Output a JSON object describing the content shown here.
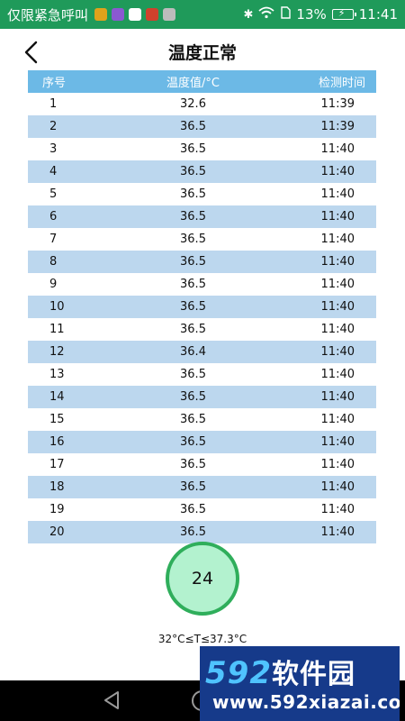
{
  "status_bar": {
    "carrier": "仅限紧急呼叫",
    "battery_percent": "13%",
    "time": "11:41",
    "notification_colors": [
      "#e0a21b",
      "#8a59d1",
      "#ffffff",
      "#d0412c",
      "#bcbcbc"
    ]
  },
  "header": {
    "title": "温度正常"
  },
  "table": {
    "columns": [
      "序号",
      "温度值/°C",
      "检测时间"
    ],
    "rows": [
      [
        "1",
        "32.6",
        "11:39"
      ],
      [
        "2",
        "36.5",
        "11:39"
      ],
      [
        "3",
        "36.5",
        "11:40"
      ],
      [
        "4",
        "36.5",
        "11:40"
      ],
      [
        "5",
        "36.5",
        "11:40"
      ],
      [
        "6",
        "36.5",
        "11:40"
      ],
      [
        "7",
        "36.5",
        "11:40"
      ],
      [
        "8",
        "36.5",
        "11:40"
      ],
      [
        "9",
        "36.5",
        "11:40"
      ],
      [
        "10",
        "36.5",
        "11:40"
      ],
      [
        "11",
        "36.5",
        "11:40"
      ],
      [
        "12",
        "36.4",
        "11:40"
      ],
      [
        "13",
        "36.5",
        "11:40"
      ],
      [
        "14",
        "36.5",
        "11:40"
      ],
      [
        "15",
        "36.5",
        "11:40"
      ],
      [
        "16",
        "36.5",
        "11:40"
      ],
      [
        "17",
        "36.5",
        "11:40"
      ],
      [
        "18",
        "36.5",
        "11:40"
      ],
      [
        "19",
        "36.5",
        "11:40"
      ],
      [
        "20",
        "36.5",
        "11:40"
      ]
    ]
  },
  "summary": {
    "count": "24",
    "range_text": "32°C≤T≤37.3°C"
  },
  "watermark": {
    "logo_number": "592",
    "logo_text": "软件园",
    "url": "www.592xiazai.com"
  },
  "colors": {
    "status_bar": "#1f9a5a",
    "table_header": "#6cb9e6",
    "table_stripe": "#bcd7ee",
    "circle_border": "#2fae5b",
    "circle_fill": "#b3f2cf"
  }
}
